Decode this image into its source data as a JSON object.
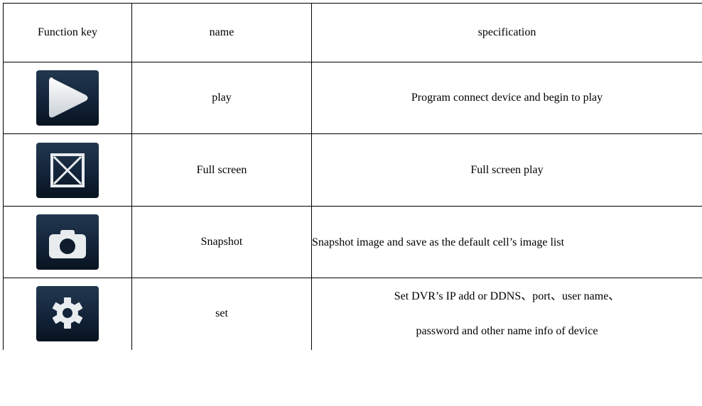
{
  "table": {
    "headers": {
      "function_key": "Function key",
      "name": "name",
      "specification": "specification"
    },
    "rows": [
      {
        "icon": "play-icon",
        "name": "play",
        "spec": "Program connect device and begin to play"
      },
      {
        "icon": "fullscreen-icon",
        "name": "Full screen",
        "spec": "Full screen play"
      },
      {
        "icon": "camera-icon",
        "name": "Snapshot",
        "spec": "Snapshot image and save as the default cell’s image list"
      },
      {
        "icon": "gear-icon",
        "name": "set",
        "spec_line1": "Set DVR’s IP add or DDNS、port、user name、",
        "spec_line2": "password and other name info of device"
      }
    ]
  },
  "colors": {
    "button_bg_top": "#1d3249",
    "button_bg_bottom": "#0a1626",
    "icon_fill": "#e8ecef"
  }
}
